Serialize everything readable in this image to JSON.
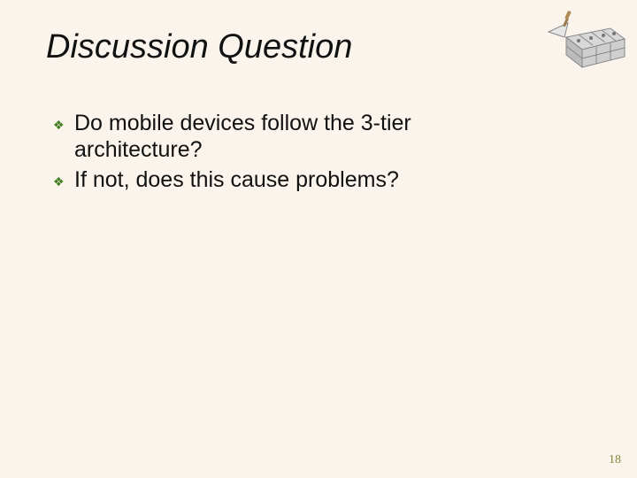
{
  "title": "Discussion Question",
  "bullets": [
    "Do mobile devices follow the 3-tier architecture?",
    "If not, does this cause problems?"
  ],
  "page_number": "18",
  "decor_alt": "bricks-trowel-icon"
}
